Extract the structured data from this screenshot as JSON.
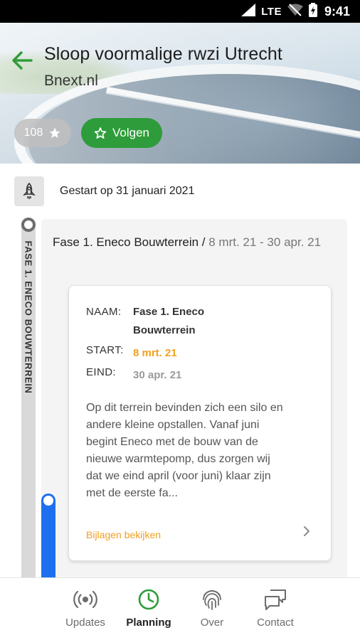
{
  "status_bar": {
    "network": "LTE",
    "time": "9:41"
  },
  "header": {
    "title": "Sloop voormalige rwzi Utrecht",
    "source": "Bnext.nl",
    "rating_count": "108",
    "follow_label": "Volgen",
    "accent_color": "#2e9c3a"
  },
  "start": {
    "text": "Gestart op 31 januari 2021",
    "icon": "rocket-icon"
  },
  "timeline": {
    "vertical_label": "FASE 1. ENECO BOUWTERREIN"
  },
  "phase": {
    "name": "Fase 1. Eneco Bouwterrein /",
    "dates": "8 mrt. 21 - 30 apr. 21"
  },
  "card": {
    "naam_label": "NAAM:",
    "naam_value": "Fase 1. Eneco Bouwterrein",
    "start_label": "START:",
    "start_value": "8 mrt. 21",
    "eind_label": "EIND:",
    "eind_value": "30 apr. 21",
    "description": "Op dit terrein bevinden zich een silo en andere kleine opstallen. Vanaf juni begint Eneco met de bouw van de nieuwe warmtepomp, dus zorgen wij dat we eind april (voor juni) klaar zijn met de eerste fa...",
    "link_label": "Bijlagen bekijken",
    "start_color": "#f0a020",
    "eind_color": "#9a9a9a"
  },
  "nav": {
    "items": [
      {
        "label": "Updates",
        "icon": "broadcast-icon"
      },
      {
        "label": "Planning",
        "icon": "clock-icon",
        "active": true
      },
      {
        "label": "Over",
        "icon": "fingerprint-icon"
      },
      {
        "label": "Contact",
        "icon": "chat-icon"
      }
    ]
  }
}
